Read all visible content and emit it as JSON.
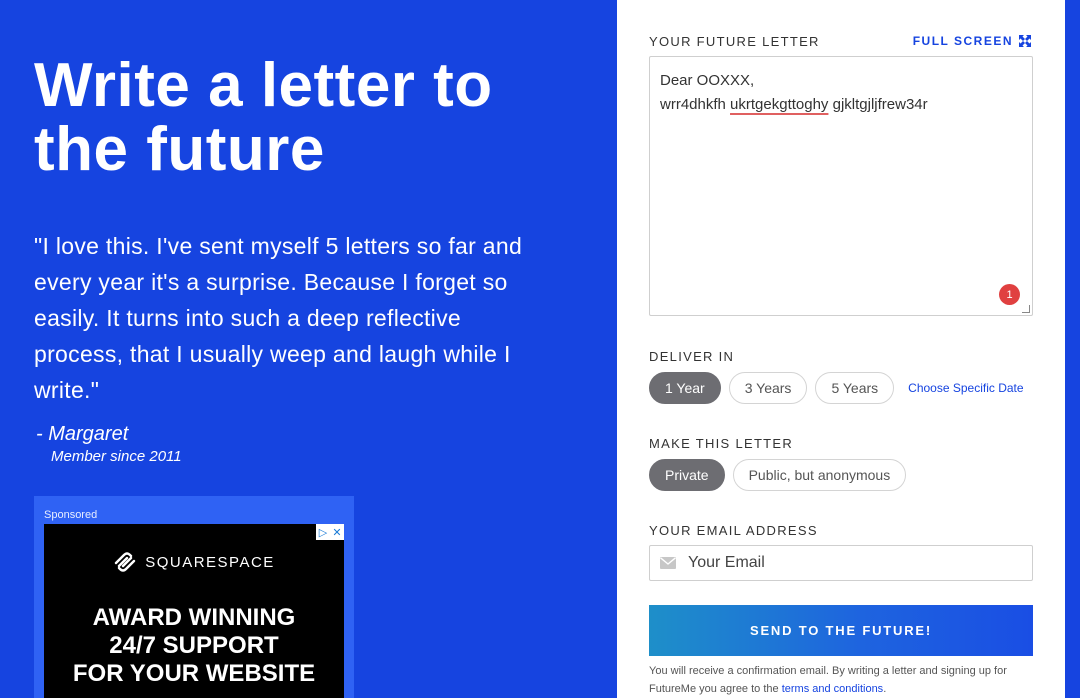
{
  "hero": {
    "title": "Write a letter to the future",
    "quote": "\"I love this. I've sent myself 5 letters so far and every year it's a surprise. Because I forget so easily. It turns into such a deep reflective process, that I usually weep and laugh while I write.\"",
    "author": "- Margaret",
    "author_sub": "Member since 2011"
  },
  "ad": {
    "label": "Sponsored",
    "brand": "SQUARESPACE",
    "headline_lines": [
      "AWARD WINNING",
      "24/7 SUPPORT",
      "FOR YOUR WEBSITE"
    ],
    "choices_icon": "adchoices-icon",
    "close_icon": "close-icon"
  },
  "form": {
    "letter_label": "YOUR FUTURE LETTER",
    "fullscreen_label": "FULL SCREEN",
    "letter_line1": "Dear OOXXX,",
    "letter_line2_a": "wrr4dhkfh ",
    "letter_line2_misspelled": "ukrtgekgttoghy",
    "letter_line2_b": " gjkltgjljfrew34r",
    "error_count": "1",
    "deliver_label": "DELIVER IN",
    "deliver_options": [
      "1 Year",
      "3 Years",
      "5 Years"
    ],
    "deliver_selected": "1 Year",
    "choose_date": "Choose Specific Date",
    "privacy_label": "MAKE THIS LETTER",
    "privacy_options": [
      "Private",
      "Public, but anonymous"
    ],
    "privacy_selected": "Private",
    "email_label": "YOUR EMAIL ADDRESS",
    "email_placeholder": "Your Email",
    "send_label": "SEND TO THE FUTURE!",
    "footnote_text": "You will receive a confirmation email. By writing a letter and signing up for FutureMe you agree to the ",
    "terms_link": "terms and conditions",
    "footnote_end": "."
  },
  "colors": {
    "brand_blue": "#1644e0",
    "pill_active": "#6d6d72",
    "error_red": "#e04040"
  }
}
